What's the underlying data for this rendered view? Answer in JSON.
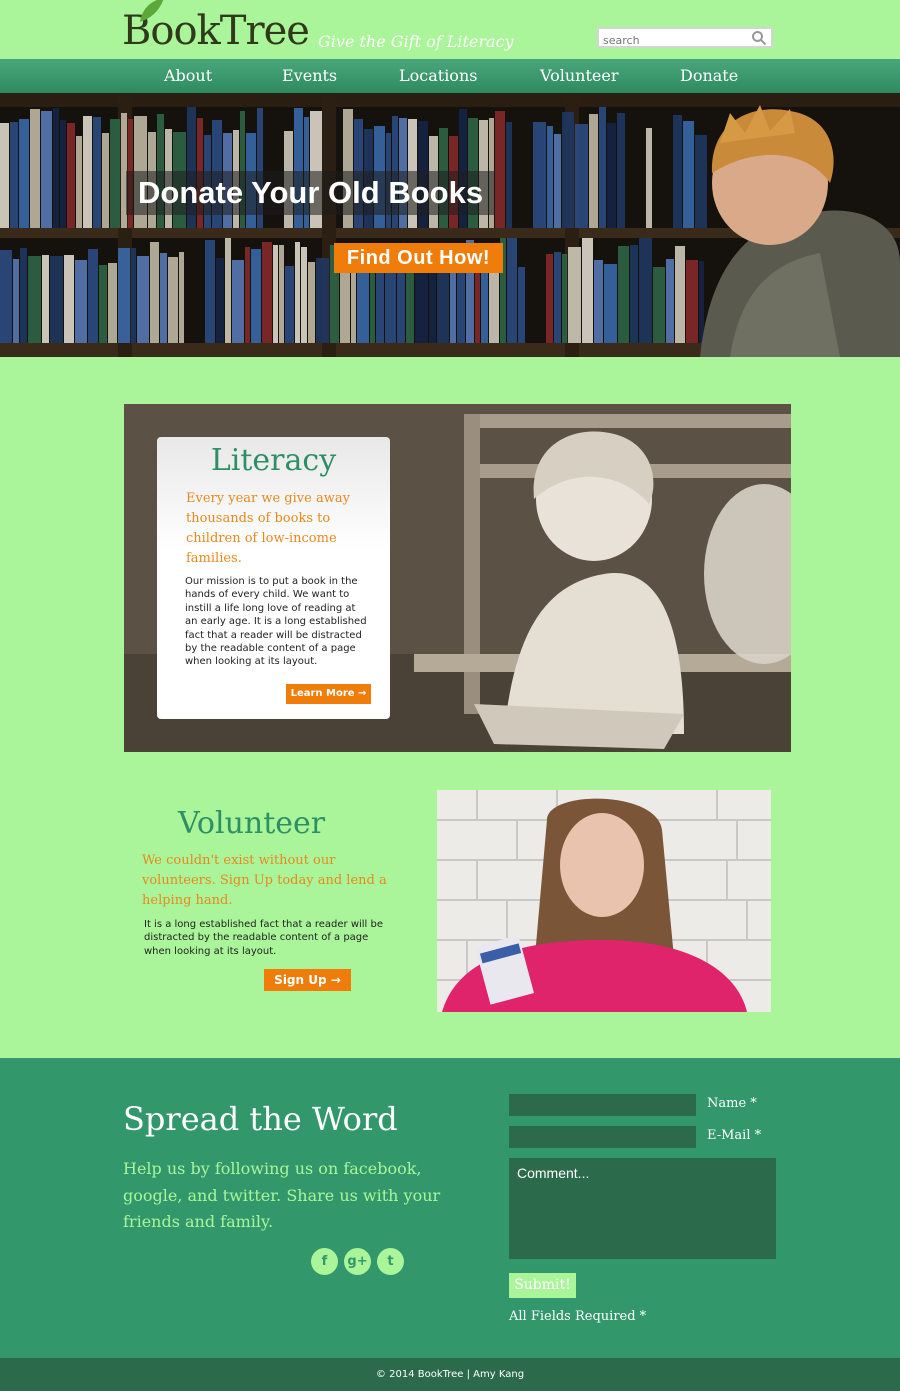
{
  "header": {
    "logo_text": "BookTree",
    "tagline": "Give the Gift of Literacy",
    "search_placeholder": "search"
  },
  "nav": {
    "items": [
      {
        "label": "About"
      },
      {
        "label": "Events"
      },
      {
        "label": "Locations"
      },
      {
        "label": "Volunteer"
      },
      {
        "label": "Donate"
      }
    ]
  },
  "hero": {
    "title": "Donate Your Old Books",
    "button": "Find Out How!"
  },
  "literacy": {
    "title": "Literacy",
    "subtitle": "Every year we give away thousands of books to children of low-income families.",
    "body": "Our mission is to put a book in the hands of every child. We want to instill a life long love of reading at an early age. It is a long established fact that a reader will be distracted by the readable content of a page when looking at its layout.",
    "button": "Learn More →"
  },
  "volunteer": {
    "title": "Volunteer",
    "subtitle": "We couldn't exist without our volunteers. Sign Up today and lend a helping hand.",
    "body": "It is a long established fact that a reader will be distracted by the readable content of a page when looking at its layout.",
    "button": "Sign Up →"
  },
  "spread": {
    "title": "Spread the Word",
    "text": "Help us by following us on facebook, google, and twitter. Share us with your friends and family.",
    "social": [
      "f",
      "g+",
      "t"
    ],
    "name_label": "Name *",
    "email_label": "E-Mail *",
    "comment_placeholder": "Comment...",
    "submit": "Submit!",
    "required_note": "All Fields Required *"
  },
  "footer": {
    "copyright": "© 2014 BookTree | Amy Kang"
  },
  "colors": {
    "background": "#aaf59a",
    "accent_green": "#32986b",
    "orange": "#f07d0a"
  }
}
